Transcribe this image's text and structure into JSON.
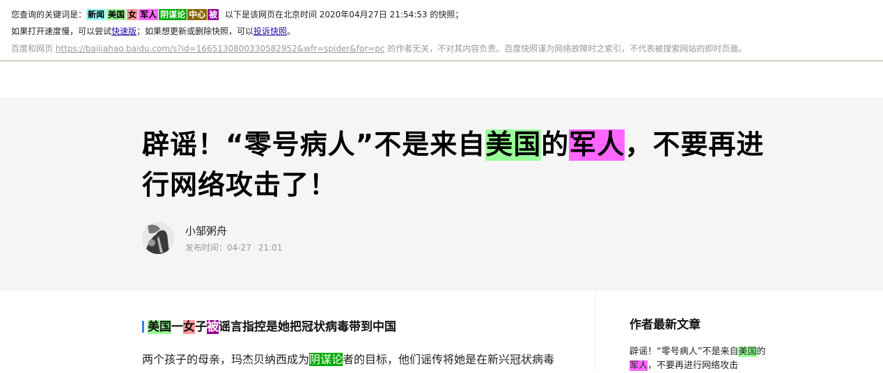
{
  "cache_header": {
    "line1_prefix": "您查询的关键词是：",
    "keywords": [
      {
        "text": "新闻",
        "bg": "#99ffff",
        "fg": "#000000"
      },
      {
        "text": "美国",
        "bg": "#99ff99",
        "fg": "#000000"
      },
      {
        "text": "女",
        "bg": "#ff9999",
        "fg": "#000000"
      },
      {
        "text": "军人",
        "bg": "#ff66ff",
        "fg": "#000000"
      },
      {
        "text": "阴谋论",
        "bg": "#00aa00",
        "fg": "#ffffff"
      },
      {
        "text": "中心",
        "bg": "#886800",
        "fg": "#ffffff"
      },
      {
        "text": "被",
        "bg": "#990099",
        "fg": "#ffffff"
      }
    ],
    "line1_suffix": "以下是该网页在北京时间 2020年04月27日 21:54:53 的快照；",
    "line2_prefix": "如果打开速度慢，可以尝试",
    "fast_link": "快速版",
    "line2_mid": "；如果想更新或删除快照，可以",
    "complain_link": "投诉快照",
    "line2_end": "。",
    "line3_prefix": "百度和网页 ",
    "source_url": "https://baijiahao.baidu.com/s?id=1665130800330582952&wfr=spider&for=pc",
    "line3_suffix": " 的作者无关，不对其内容负责。百度快照谨为网络故障时之索引，不代表被搜索网站的即时页面。"
  },
  "article": {
    "title_parts": [
      "辟谣！“零号病人”不是来自",
      "美国",
      "的",
      "军人",
      "，不要再进行网络攻击了！"
    ],
    "author": "小邹粥舟",
    "publish_label": "发布时间：04-27",
    "publish_time": "21:01",
    "section_heading_parts": [
      "美国",
      "一",
      "女",
      "子",
      "被",
      "谣言指控是她把冠状病毒带到中国"
    ],
    "paragraph_parts": [
      "两个孩子的母亲，玛杰贝纳西成为",
      "阴谋论",
      "者的目标，他们谣传将她是在新兴冠状病毒"
    ]
  },
  "sidebar": {
    "title": "作者最新文章",
    "latest_parts": [
      "辟谣！“零号病人”不是来自",
      "美国",
      "的",
      "军人",
      "，不要再进行网络攻击"
    ]
  },
  "colors": {
    "hl_meiguo": "#99ff99",
    "hl_junren": "#ff66ff",
    "hl_yinmoulun": "#00aa00",
    "hl_nv": "#ff9999",
    "hl_bei": "#990099",
    "section_bar": "#3c7cfc"
  },
  "icons": {
    "avatar": "author-avatar-photo"
  }
}
